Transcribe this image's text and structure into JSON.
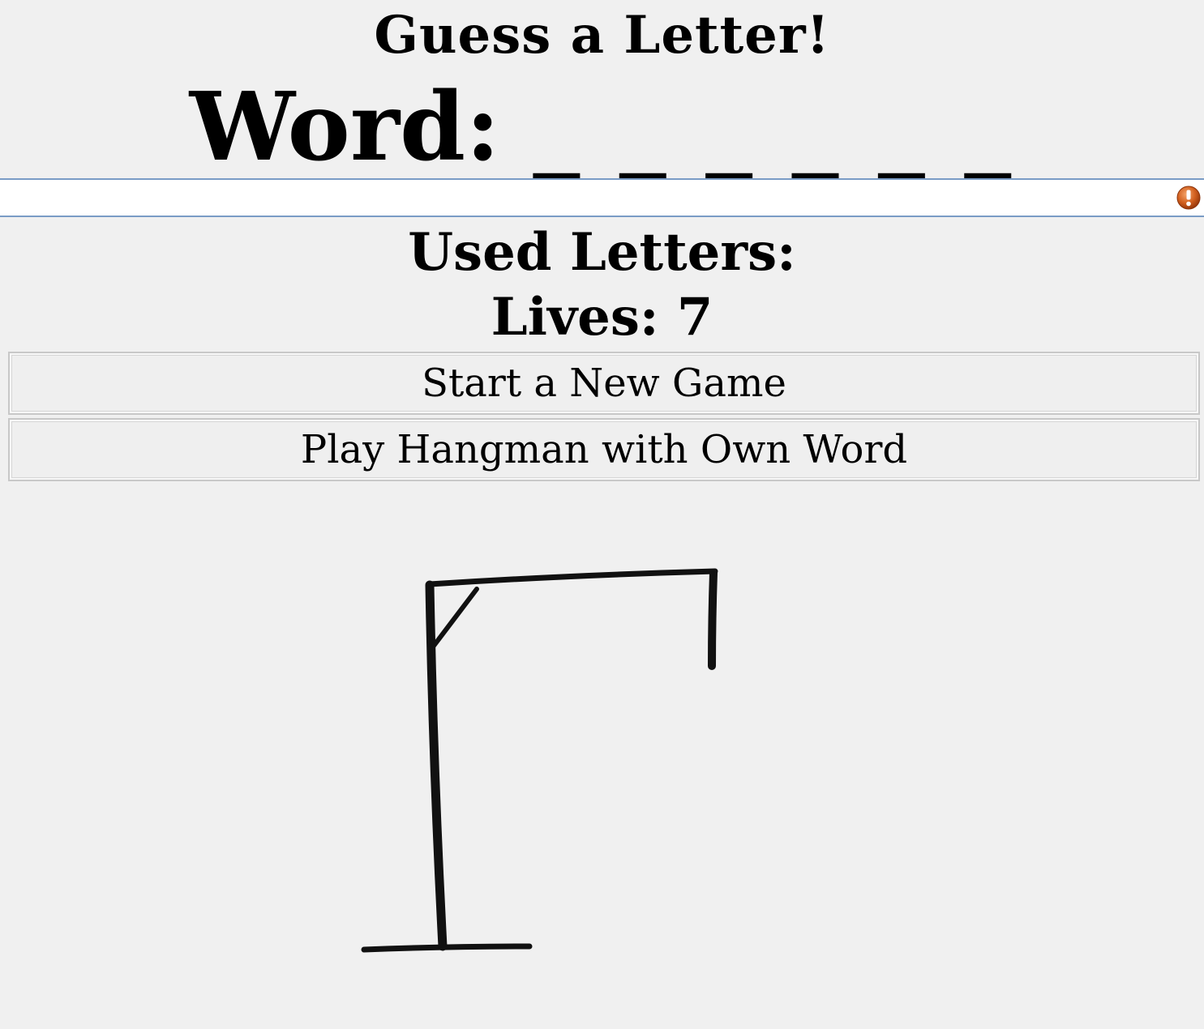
{
  "game": {
    "title": "Guess a Letter!",
    "word_label": "Word:",
    "word_slots": "_ _ _ _ _ _",
    "used_letters_label": "Used Letters:",
    "lives_label": "Lives: 7",
    "lives": 7
  },
  "guess_input": {
    "value": "",
    "placeholder": ""
  },
  "icons": {
    "warning": "warning-icon"
  },
  "buttons": {
    "new_game": "Start a New Game",
    "own_word": "Play Hangman with Own Word"
  },
  "colors": {
    "background": "#f0f0f0",
    "input_border": "#7a9cc6",
    "warning": "#c8531a"
  }
}
